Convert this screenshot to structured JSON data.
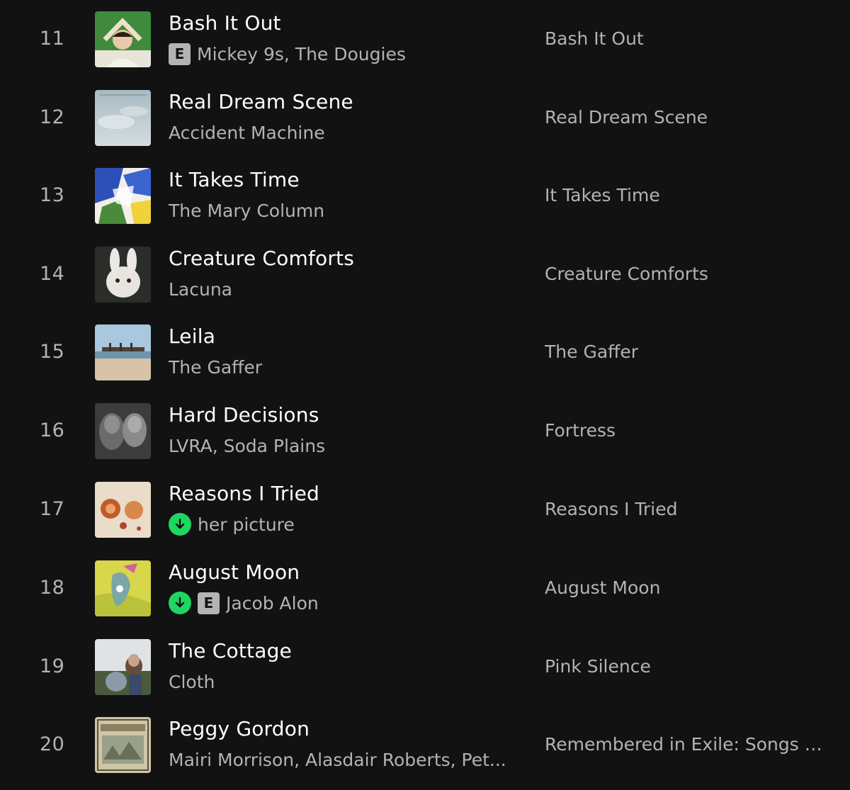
{
  "tracks": [
    {
      "number": "11",
      "title": "Bash It Out",
      "explicit": true,
      "downloaded": false,
      "artists": "Mickey 9s, The Dougies",
      "album": "Bash It Out",
      "explicit_label": "E"
    },
    {
      "number": "12",
      "title": "Real Dream Scene",
      "explicit": false,
      "downloaded": false,
      "artists": "Accident Machine",
      "album": "Real Dream Scene"
    },
    {
      "number": "13",
      "title": "It Takes Time",
      "explicit": false,
      "downloaded": false,
      "artists": "The Mary Column",
      "album": "It Takes Time"
    },
    {
      "number": "14",
      "title": "Creature Comforts",
      "explicit": false,
      "downloaded": false,
      "artists": "Lacuna",
      "album": "Creature Comforts"
    },
    {
      "number": "15",
      "title": "Leila",
      "explicit": false,
      "downloaded": false,
      "artists": "The Gaffer",
      "album": "The Gaffer"
    },
    {
      "number": "16",
      "title": "Hard Decisions",
      "explicit": false,
      "downloaded": false,
      "artists": "LVRA, Soda Plains",
      "album": "Fortress"
    },
    {
      "number": "17",
      "title": "Reasons I Tried",
      "explicit": false,
      "downloaded": true,
      "artists": "her picture",
      "album": "Reasons I Tried"
    },
    {
      "number": "18",
      "title": "August Moon",
      "explicit": true,
      "downloaded": true,
      "artists": "Jacob Alon",
      "album": "August Moon",
      "explicit_label": "E"
    },
    {
      "number": "19",
      "title": "The Cottage",
      "explicit": false,
      "downloaded": false,
      "artists": "Cloth",
      "album": "Pink Silence"
    },
    {
      "number": "20",
      "title": "Peggy Gordon",
      "explicit": false,
      "downloaded": false,
      "artists": "Mairi Morrison, Alasdair Roberts, Pet...",
      "album": "Remembered in Exile: Songs a..."
    }
  ],
  "colors": {
    "background": "#121212",
    "primary_text": "#ffffff",
    "secondary_text": "#b3b3b3",
    "download_green": "#1ed760"
  },
  "icons": {
    "downloaded": "download-arrow-icon",
    "explicit": "explicit-badge"
  }
}
